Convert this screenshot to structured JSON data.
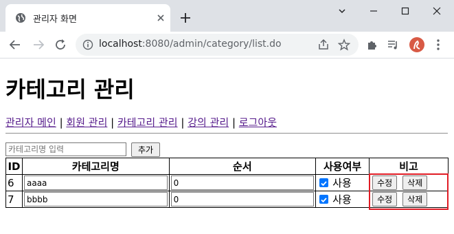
{
  "browser": {
    "tab_title": "관리자 화면",
    "url_host": "localhost",
    "url_rest": ":8080/admin/category/list.do"
  },
  "page": {
    "title": "카테고리 관리",
    "nav": [
      {
        "label": "관리자 메인"
      },
      {
        "label": "회원 관리"
      },
      {
        "label": "카테고리 관리"
      },
      {
        "label": "강의 관리"
      },
      {
        "label": "로그아웃"
      }
    ],
    "nav_separator": "|",
    "add_form": {
      "placeholder": "카테고리명 입력",
      "add_label": "추가"
    },
    "table": {
      "headers": [
        "ID",
        "카테고리명",
        "순서",
        "사용여부",
        "비고"
      ],
      "rows": [
        {
          "id": "6",
          "name": "aaaa",
          "order": "0",
          "use_label": "사용",
          "edit_label": "수정",
          "delete_label": "삭제"
        },
        {
          "id": "7",
          "name": "bbbb",
          "order": "0",
          "use_label": "사용",
          "edit_label": "수정",
          "delete_label": "삭제"
        }
      ]
    }
  },
  "colors": {
    "link": "#551a8b",
    "highlight": "#e01b24",
    "checkbox": "#0075ff"
  }
}
